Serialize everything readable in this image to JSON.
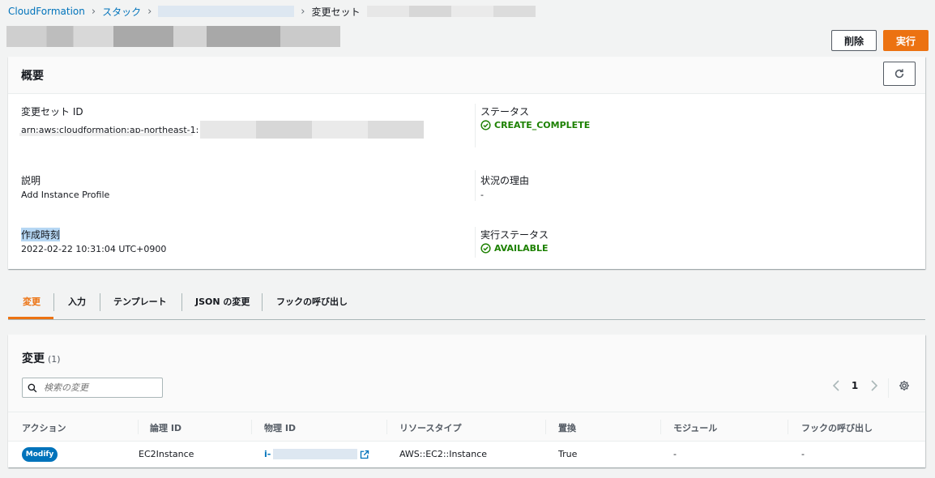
{
  "breadcrumb": {
    "items": [
      "CloudFormation",
      "スタック"
    ],
    "current": "変更セット"
  },
  "header": {
    "delete_label": "削除",
    "execute_label": "実行"
  },
  "overview": {
    "title": "概要",
    "changeset_id_label": "変更セット ID",
    "changeset_id_value": "arn:aws:cloudformation:ap-northeast-1:",
    "status_label": "ステータス",
    "status_value": "CREATE_COMPLETE",
    "description_label": "説明",
    "description_value": "Add Instance Profile",
    "reason_label": "状況の理由",
    "reason_value": "-",
    "created_label": "作成時刻",
    "created_value": "2022-02-22 10:31:04 UTC+0900",
    "exec_status_label": "実行ステータス",
    "exec_status_value": "AVAILABLE"
  },
  "tabs": [
    {
      "label": "変更",
      "active": true
    },
    {
      "label": "入力",
      "active": false
    },
    {
      "label": "テンプレート",
      "active": false
    },
    {
      "label": "JSON の変更",
      "active": false
    },
    {
      "label": "フックの呼び出し",
      "active": false
    }
  ],
  "changes": {
    "title": "変更",
    "count": "(1)",
    "search_placeholder": "検索の変更",
    "page": "1",
    "columns": [
      "アクション",
      "論理 ID",
      "物理 ID",
      "リソースタイプ",
      "置換",
      "モジュール",
      "フックの呼び出し"
    ],
    "rows": [
      {
        "action": "Modify",
        "logical_id": "EC2Instance",
        "physical_id_prefix": "i-",
        "resource_type": "AWS::EC2::Instance",
        "replacement": "True",
        "module": "-",
        "hooks": "-"
      }
    ]
  },
  "colors": {
    "accent": "#ec7211",
    "link": "#0073bb",
    "success": "#1d8102"
  },
  "icons": [
    "chevron-right-icon",
    "refresh-icon",
    "check-circle-icon",
    "search-icon",
    "chevron-left-icon",
    "gear-icon",
    "external-link-icon"
  ]
}
